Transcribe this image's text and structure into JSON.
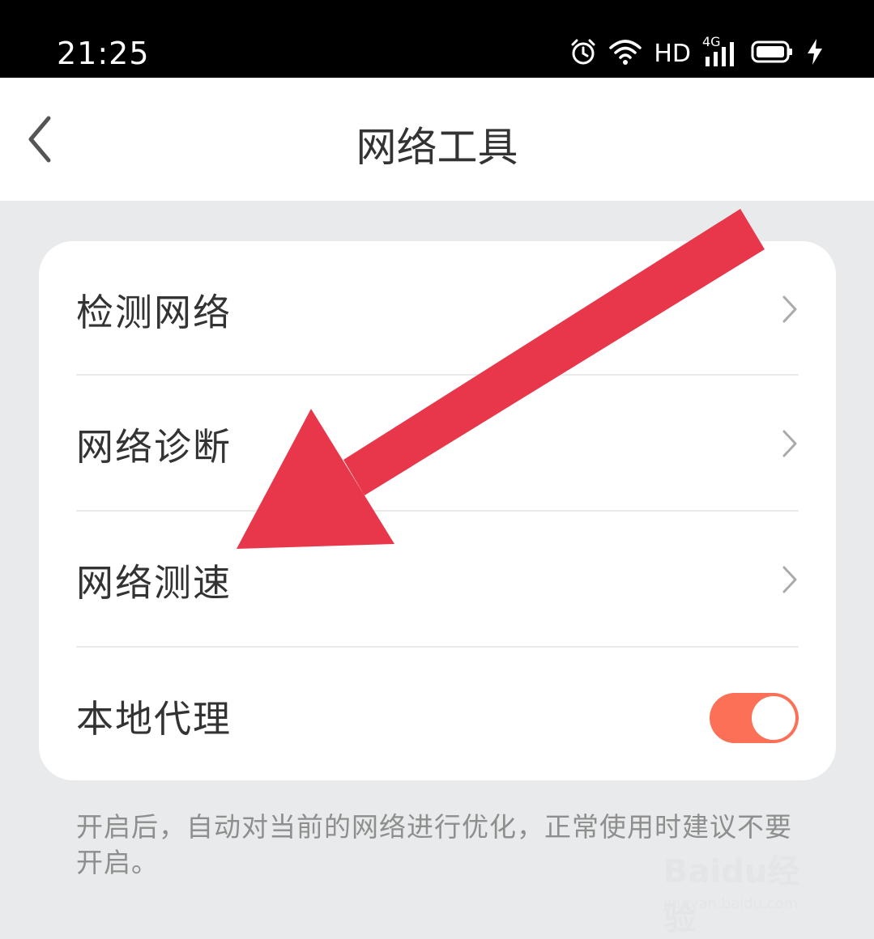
{
  "status_bar": {
    "time": "21:25",
    "hd_label": "HD",
    "network_label": "4G",
    "icons": [
      "alarm-icon",
      "wifi-icon",
      "signal-icon",
      "battery-icon",
      "charging-icon"
    ]
  },
  "header": {
    "title": "网络工具",
    "back_icon": "chevron-left-icon"
  },
  "menu": {
    "items": [
      {
        "label": "检测网络",
        "icon": "chevron-right-icon"
      },
      {
        "label": "网络诊断",
        "icon": "chevron-right-icon"
      },
      {
        "label": "网络测速",
        "icon": "chevron-right-icon"
      },
      {
        "label": "本地代理",
        "control": "toggle",
        "toggle_on": true
      }
    ]
  },
  "hint_text": "开启后，自动对当前的网络进行优化，正常使用时建议不要开启。",
  "annotation": {
    "arrow_color": "#e8374a",
    "points_to": "网络测速"
  },
  "watermark": {
    "brand": "Baidu经验",
    "url": "jingyan.baidu.com"
  },
  "colors": {
    "toggle_on": "#fb7056",
    "background": "#e8eaeb",
    "arrow": "#e8374a"
  }
}
